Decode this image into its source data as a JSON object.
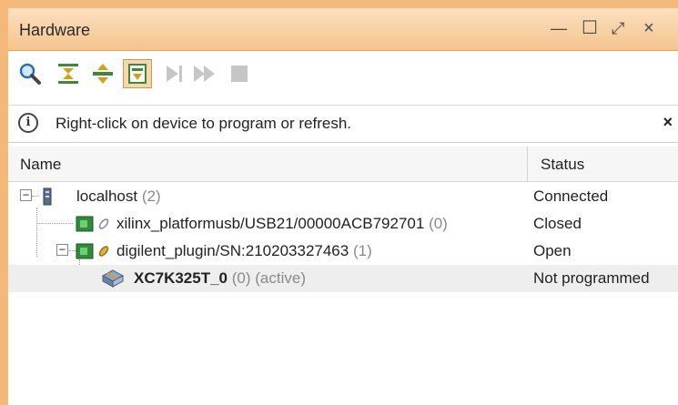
{
  "window": {
    "title": "Hardware",
    "controls": {
      "minimize": "—",
      "maximize": "☐",
      "restore": "⤢",
      "close": "×"
    }
  },
  "toolbar": {
    "buttons": [
      {
        "icon": "search-icon",
        "active": false
      },
      {
        "icon": "collapse-all-icon",
        "active": false
      },
      {
        "icon": "expand-all-icon",
        "active": false
      },
      {
        "icon": "auto-connect-icon",
        "active": true
      },
      {
        "icon": "step-icon",
        "active": false
      },
      {
        "icon": "run-icon",
        "active": false
      },
      {
        "icon": "stop-icon",
        "active": false
      }
    ]
  },
  "info": {
    "icon": "i",
    "message": "Right-click on device to program or refresh.",
    "close": "×"
  },
  "table": {
    "columns": {
      "name": "Name",
      "status": "Status"
    },
    "rows": [
      {
        "name": "localhost",
        "count": "(2)",
        "status": "Connected",
        "icon": "server-icon"
      },
      {
        "name": "xilinx_platformusb/USB21/00000ACB792701",
        "count": "(0)",
        "status": "Closed",
        "icon": "board-icon"
      },
      {
        "name": "digilent_plugin/SN:210203327463",
        "count": "(1)",
        "status": "Open",
        "icon": "board-icon"
      },
      {
        "name": "XC7K325T_0",
        "count": "(0)",
        "extra": "(active)",
        "status": "Not programmed",
        "icon": "fpga-chip-icon"
      }
    ]
  },
  "colors": {
    "accent": "#f5c48e",
    "border": "#e0a866",
    "selection": "#eeeeee"
  }
}
